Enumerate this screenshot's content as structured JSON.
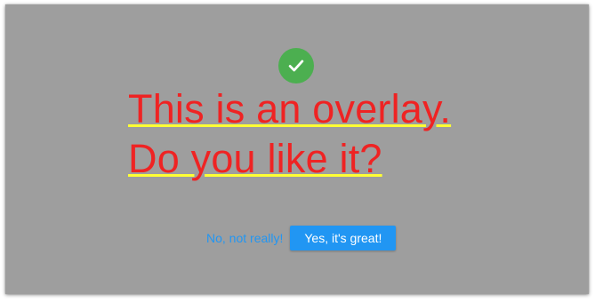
{
  "overlay": {
    "title_lines": [
      "This is an overlay.",
      "Do you like it?"
    ],
    "colors": {
      "backdrop": "#9e9e9e",
      "title_text": "#ef2323",
      "title_underline": "#ffff33",
      "success": "#4caf50",
      "primary": "#2196f3"
    },
    "icon": "check-icon",
    "actions": {
      "decline_label": "No, not really!",
      "accept_label": "Yes, it's great!"
    }
  }
}
